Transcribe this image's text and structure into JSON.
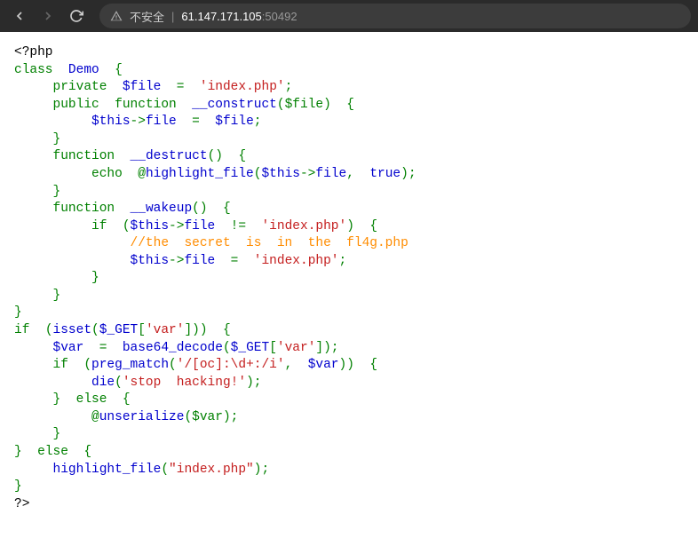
{
  "browser": {
    "security_label": "不安全",
    "url_host": "61.147.171.105",
    "url_port": ":50492"
  },
  "code": {
    "open_tag": "<?php",
    "class_kw": "class",
    "class_name": "Demo",
    "lbrace": "{",
    "rbrace": "}",
    "private_kw": "private",
    "file_var": "$file",
    "eq": "=",
    "index_php_s": "'index.php'",
    "semi": ";",
    "public_kw": "public",
    "function_kw": "function",
    "construct": "__construct",
    "file_param": "($file)",
    "this": "$this",
    "arrow": "->",
    "file_prop": "file",
    "destruct": "__destruct",
    "empty_paren": "()",
    "echo": "echo",
    "at": "@",
    "highlight_file": "highlight_file",
    "hf_args_open": "(",
    "hf_args_close": ")",
    "comma": ",",
    "true": "true",
    "wakeup": "__wakeup",
    "if_kw": "if",
    "neq": "!=",
    "comment_secret": "//the  secret  is  in  the  fl4g.php",
    "isset": "isset",
    "get": "$_GET",
    "var_key": "'var'",
    "var_var": "$var",
    "b64": "base64_decode",
    "preg": "preg_match",
    "regex": "'/[oc]:\\d+:/i'",
    "die": "die",
    "stop": "'stop  hacking!'",
    "else_kw": "else",
    "unser": "unserialize",
    "var_arg": "($var)",
    "hf2_arg": "\"index.php\"",
    "close_tag": "?>"
  }
}
